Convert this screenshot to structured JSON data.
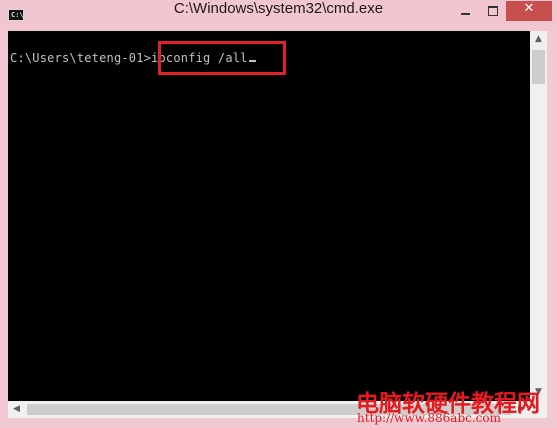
{
  "window": {
    "title": "C:\\Windows\\system32\\cmd.exe",
    "icon_text": "C:\\",
    "controls": {
      "minimize": "minimize-icon",
      "maximize": "maximize-icon",
      "close": "close-icon",
      "close_glyph": "✕"
    }
  },
  "console": {
    "prompt": "C:\\Users\\teteng-01>",
    "command": "ipconfig /all",
    "highlight_color": "#e0212a"
  },
  "watermark": {
    "chinese": "电脑软硬件教程网",
    "url": "http://www.886abc.com",
    "color": "#e8191f"
  },
  "scrollbars": {
    "up": "▲",
    "down": "▼",
    "left": "◀",
    "right": "▶"
  }
}
